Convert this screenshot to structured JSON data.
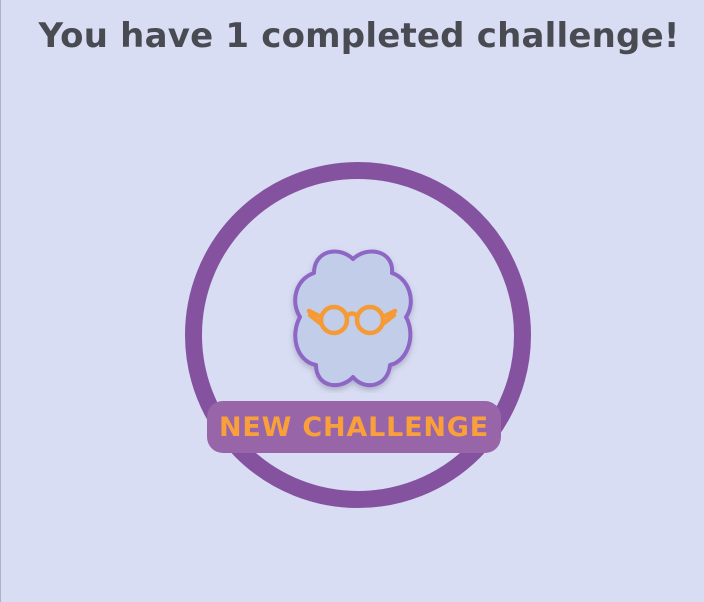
{
  "header": {
    "completed_message": "You have 1 completed challenge!"
  },
  "badge": {
    "icon": "glasses-icon"
  },
  "actions": {
    "new_challenge_label": "NEW CHALLENGE"
  },
  "colors": {
    "background": "#d8ddf3",
    "ring": "#85529f",
    "badge_fill": "#c2cde9",
    "badge_border": "#8e66c6",
    "icon": "#f59a35",
    "button_bg": "#9866a8",
    "button_text": "#f9a03a",
    "headline_text": "#4a4b52"
  }
}
